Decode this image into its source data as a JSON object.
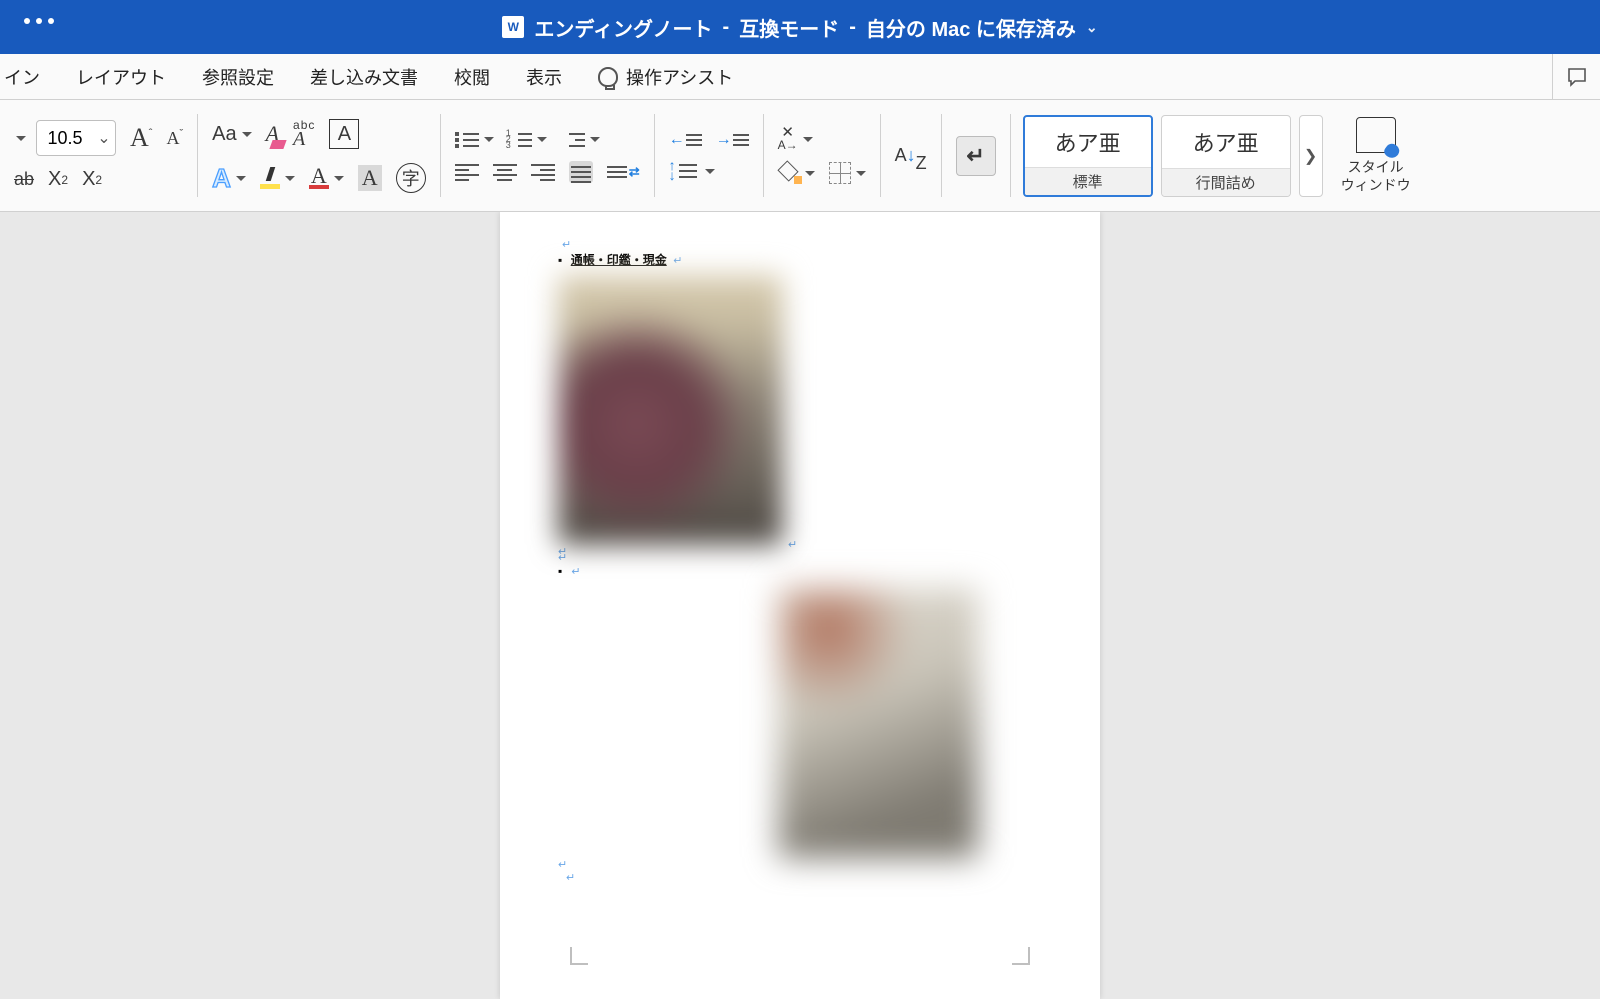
{
  "titlebar": {
    "filename": "エンディングノート",
    "mode": "互換モード",
    "save_state": "自分の Mac に保存済み"
  },
  "tabs": {
    "items": [
      "イン",
      "レイアウト",
      "参照設定",
      "差し込み文書",
      "校閲",
      "表示"
    ],
    "assist": "操作アシスト"
  },
  "ribbon": {
    "font_size": "10.5",
    "styles": [
      {
        "preview": "あア亜",
        "label": "標準",
        "selected": true
      },
      {
        "preview": "あア亜",
        "label": "行間詰め",
        "selected": false
      }
    ],
    "style_pane": {
      "line1": "スタイル",
      "line2": "ウィンドウ"
    }
  },
  "document": {
    "heading": "通帳・印鑑・現金"
  }
}
